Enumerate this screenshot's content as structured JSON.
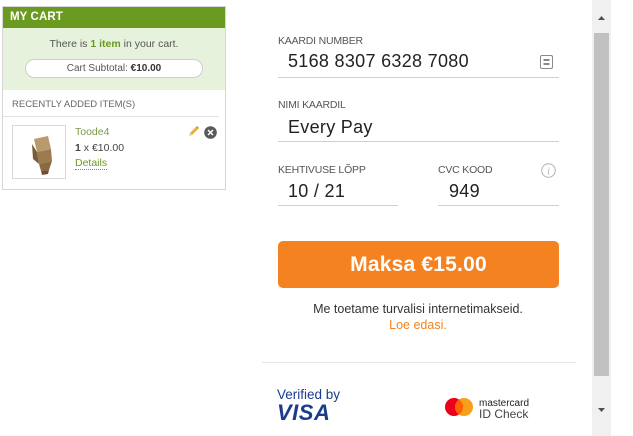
{
  "cart": {
    "title": "MY CART",
    "summary_prefix": "There is ",
    "item_count": "1 item",
    "summary_suffix": " in your cart.",
    "subtotal_label": "Cart Subtotal: ",
    "subtotal_value": "€10.00",
    "recent_label": "RECENTLY ADDED ITEM(S)",
    "item": {
      "name": "Toode4",
      "qty": "1",
      "price": "€10.00",
      "details_label": "Details"
    }
  },
  "payment": {
    "card_number_label": "KAARDI NUMBER",
    "card_number_value": "5168 8307 6328 7080",
    "name_label": "NIMI KAARDIL",
    "name_value": "Every Pay",
    "expiry_label": "KEHTIVUSE LÕPP",
    "expiry_value": "10 / 21",
    "cvc_label": "CVC KOOD",
    "cvc_value": "949",
    "pay_button_label": "Maksa €15.00",
    "secure_text": "Me toetame turvalisi internetimakseid.",
    "read_more": "Loe edasi.",
    "verified_by": "Verified by",
    "visa": "VISA",
    "mastercard_brand": "mastercard",
    "mastercard_id_check": "ID Check"
  },
  "colors": {
    "cart_header": "#6a9a1f",
    "cart_summary_bg": "#e7f2dc",
    "pay_button": "#f58220",
    "link_orange": "#f58220",
    "visa_blue": "#1a3b8e"
  },
  "icons": {
    "edit": "pencil-icon",
    "remove": "close-circle-icon",
    "card": "card-icon",
    "info": "info-icon"
  }
}
